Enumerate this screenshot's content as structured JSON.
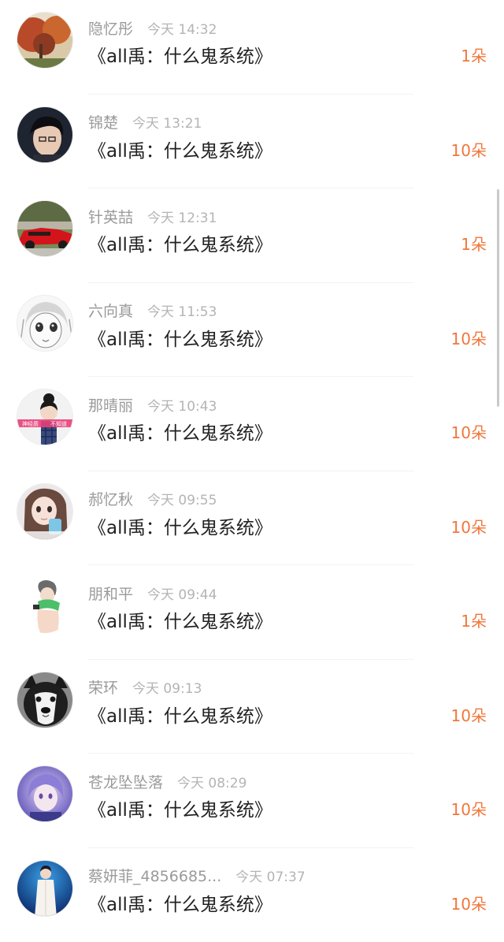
{
  "notifications": [
    {
      "name": "隐忆彤",
      "time": "今天 14:32",
      "title": "《all禹：什么鬼系统》",
      "count": "1朵",
      "avatar_icon": "autumn-tree-photo"
    },
    {
      "name": "锦楚",
      "time": "今天 13:21",
      "title": "《all禹：什么鬼系统》",
      "count": "10朵",
      "avatar_icon": "boy-portrait-photo"
    },
    {
      "name": "针英喆",
      "time": "今天 12:31",
      "title": "《all禹：什么鬼系统》",
      "count": "1朵",
      "avatar_icon": "red-sports-car-photo"
    },
    {
      "name": "六向真",
      "time": "今天 11:53",
      "title": "《all禹：什么鬼系统》",
      "count": "10朵",
      "avatar_icon": "manga-sketch-girl"
    },
    {
      "name": "那晴丽",
      "time": "今天 10:43",
      "title": "《all禹：什么鬼系统》",
      "count": "10朵",
      "avatar_icon": "cartoon-girl-sticker",
      "avatar_text": [
        "神经质",
        "不知道"
      ]
    },
    {
      "name": "郝忆秋",
      "time": "今天 09:55",
      "title": "《all禹：什么鬼系统》",
      "count": "10朵",
      "avatar_icon": "anime-girl-photo"
    },
    {
      "name": "朋和平",
      "time": "今天 09:44",
      "title": "《all禹：什么鬼系统》",
      "count": "1朵",
      "avatar_icon": "anime-boy-green-scarf"
    },
    {
      "name": "荣环",
      "time": "今天 09:13",
      "title": "《all禹：什么鬼系统》",
      "count": "10朵",
      "avatar_icon": "husky-dog-photo"
    },
    {
      "name": "苍龙坠坠落",
      "time": "今天 08:29",
      "title": "《all禹：什么鬼系统》",
      "count": "10朵",
      "avatar_icon": "purple-anime-boy"
    },
    {
      "name": "蔡妍菲_4856685...",
      "time": "今天 07:37",
      "title": "《all禹：什么鬼系统》",
      "count": "10朵",
      "avatar_icon": "stage-performer-photo"
    }
  ],
  "colors": {
    "accent": "#f0773c",
    "name": "#9a9a9a",
    "time": "#b4b4b4",
    "title": "#222222"
  }
}
